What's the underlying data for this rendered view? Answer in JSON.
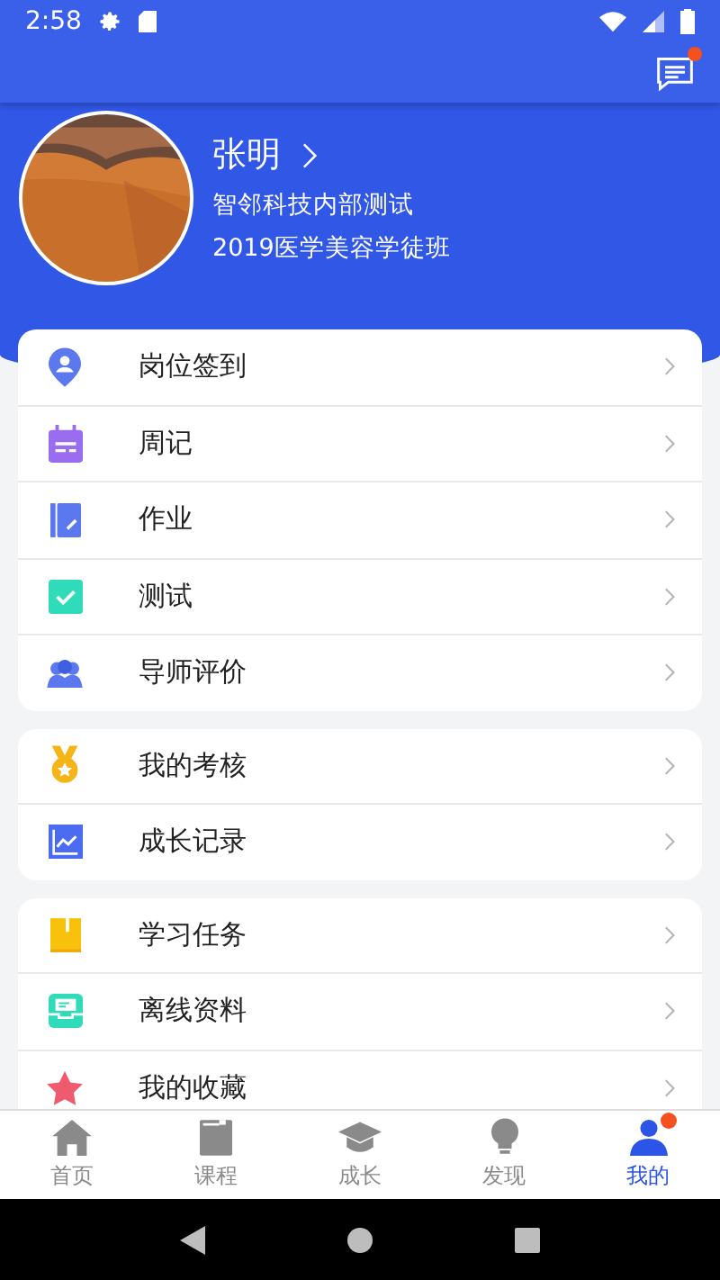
{
  "status_bar": {
    "time": "2:58"
  },
  "profile": {
    "name": "张明",
    "org": "智邻科技内部测试",
    "class_name": "2019医学美容学徒班"
  },
  "message_badge": true,
  "sections": [
    {
      "items": [
        {
          "label": "岗位签到"
        },
        {
          "label": "周记"
        },
        {
          "label": "作业"
        },
        {
          "label": "测试"
        },
        {
          "label": "导师评价"
        }
      ]
    },
    {
      "items": [
        {
          "label": "我的考核"
        },
        {
          "label": "成长记录"
        }
      ]
    },
    {
      "items": [
        {
          "label": "学习任务"
        },
        {
          "label": "离线资料"
        },
        {
          "label": "我的收藏"
        }
      ]
    }
  ],
  "tabs": [
    {
      "label": "首页",
      "selected": false,
      "badge": false
    },
    {
      "label": "课程",
      "selected": false,
      "badge": false
    },
    {
      "label": "成长",
      "selected": false,
      "badge": false
    },
    {
      "label": "发现",
      "selected": false,
      "badge": false
    },
    {
      "label": "我的",
      "selected": true,
      "badge": true
    }
  ]
}
